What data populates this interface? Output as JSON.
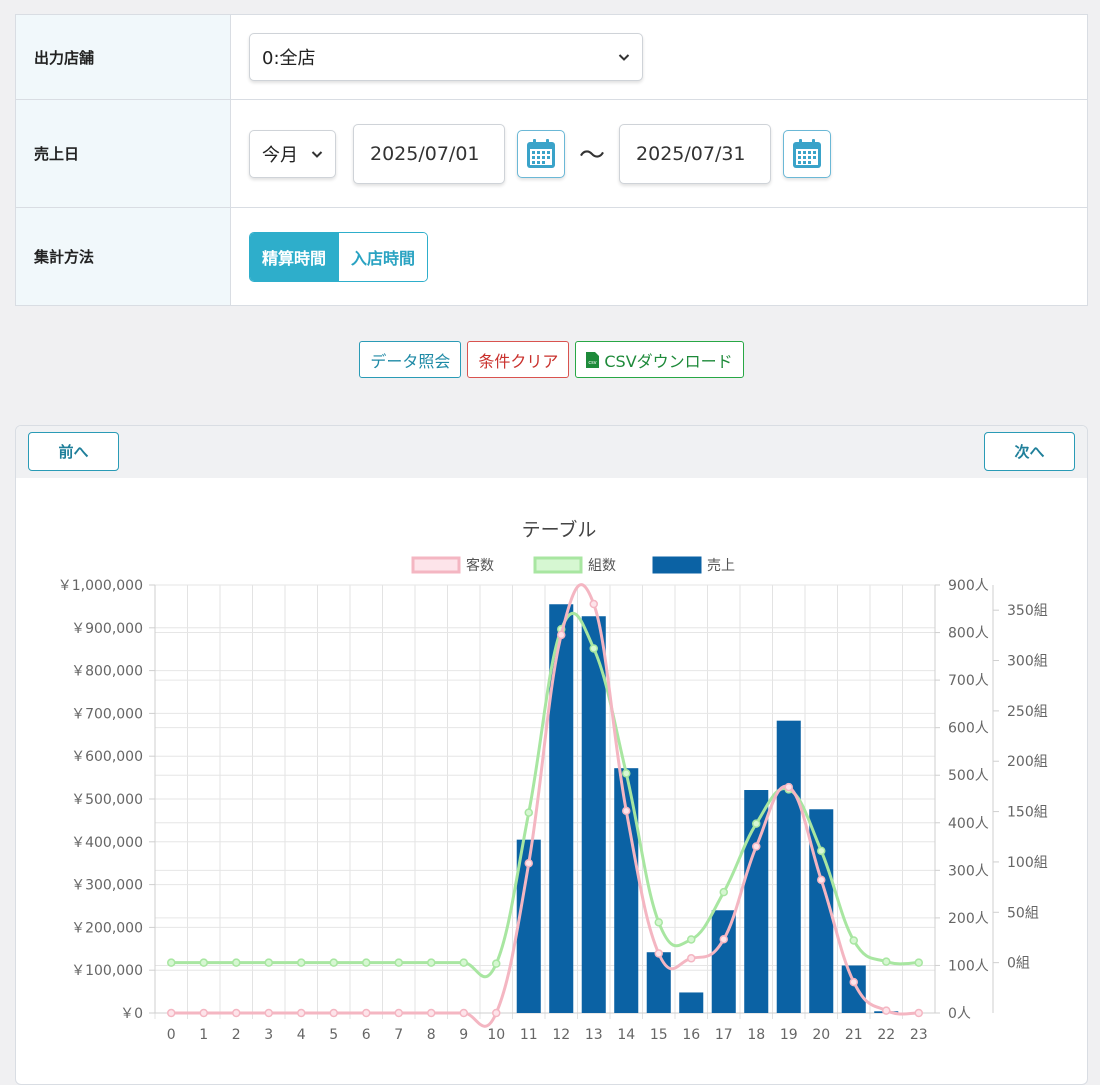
{
  "form": {
    "store": {
      "label": "出力店舗",
      "value": "0:全店"
    },
    "sales_date": {
      "label": "売上日",
      "period": "今月",
      "from": "2025/07/01",
      "separator": "〜",
      "to": "2025/07/31"
    },
    "method": {
      "label": "集計方法",
      "options": [
        "精算時間",
        "入店時間"
      ],
      "selected": "精算時間"
    }
  },
  "actions": {
    "query": "データ照会",
    "clear": "条件クリア",
    "csv": "CSVダウンロード",
    "csv_icon_text": "csv"
  },
  "nav": {
    "prev": "前へ",
    "next": "次へ"
  },
  "colors": {
    "accent": "#2eaecb",
    "bar": "#0b62a4",
    "customers": "#f4b6c2",
    "groups": "#a8e6a1"
  },
  "icons": {
    "calendar": "calendar-icon",
    "dropdown": "chevron-down-icon",
    "file": "file-csv-icon"
  },
  "chart_data": {
    "type": "bar",
    "title": "テーブル",
    "legend": {
      "position": "top",
      "items": [
        "客数",
        "組数",
        "売上"
      ]
    },
    "x": [
      0,
      1,
      2,
      3,
      4,
      5,
      6,
      7,
      8,
      9,
      10,
      11,
      12,
      13,
      14,
      15,
      16,
      17,
      18,
      19,
      20,
      21,
      22,
      23
    ],
    "x_ticks": [
      "0",
      "1",
      "2",
      "3",
      "4",
      "5",
      "6",
      "7",
      "8",
      "9",
      "10",
      "11",
      "12",
      "13",
      "14",
      "15",
      "16",
      "17",
      "18",
      "19",
      "20",
      "21",
      "22",
      "23"
    ],
    "series": [
      {
        "name": "売上",
        "type": "bar",
        "axis": "y_left",
        "values": [
          0,
          0,
          0,
          0,
          0,
          0,
          0,
          0,
          0,
          0,
          0,
          405000,
          955000,
          927000,
          572000,
          142000,
          48000,
          240000,
          521000,
          683000,
          476000,
          111000,
          4000,
          0
        ]
      },
      {
        "name": "客数",
        "type": "line",
        "axis": "y_right1",
        "values": [
          0,
          0,
          0,
          0,
          0,
          0,
          0,
          0,
          0,
          0,
          0,
          315,
          795,
          860,
          425,
          125,
          115,
          155,
          350,
          475,
          280,
          65,
          5,
          0
        ]
      },
      {
        "name": "組数",
        "type": "line",
        "axis": "y_right2",
        "values": [
          0,
          0,
          0,
          0,
          0,
          0,
          0,
          0,
          0,
          0,
          -1,
          149,
          331,
          312,
          188,
          40,
          23,
          70,
          138,
          172,
          111,
          22,
          1,
          0
        ]
      }
    ],
    "axes": {
      "y_left": {
        "min": 0,
        "max": 1000000,
        "step": 100000,
        "tick_labels": [
          "￥0",
          "￥100,000",
          "￥200,000",
          "￥300,000",
          "￥400,000",
          "￥500,000",
          "￥600,000",
          "￥700,000",
          "￥800,000",
          "￥900,000",
          "￥1,000,000"
        ]
      },
      "y_right1": {
        "min": 0,
        "max": 900,
        "step": 100,
        "tick_labels": [
          "0人",
          "100人",
          "200人",
          "300人",
          "400人",
          "500人",
          "600人",
          "700人",
          "800人",
          "900人"
        ]
      },
      "y_right2": {
        "min": -50,
        "max": 375,
        "step": 50,
        "tick_labels": [
          "0組",
          "50組",
          "100組",
          "150組",
          "200組",
          "250組",
          "300組",
          "350組"
        ]
      }
    },
    "grid": true
  }
}
